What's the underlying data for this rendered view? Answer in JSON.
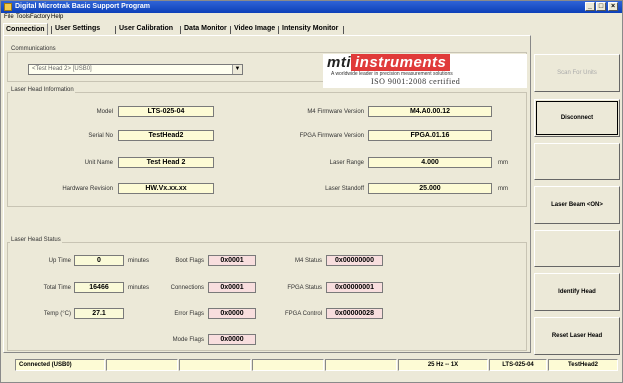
{
  "window": {
    "title": "Digital Microtrak Basic Support Program"
  },
  "menu": [
    "File",
    "Tools",
    "Factory",
    "Help"
  ],
  "tabs": [
    "Connection",
    "User Settings",
    "User Calibration",
    "Data Monitor",
    "Video Image",
    "Intensity Monitor"
  ],
  "communications": {
    "group_label": "Communications",
    "device_select": "<Test Head 2>   [USB0]"
  },
  "logo": {
    "brand_mti": "mti",
    "brand_instruments": "instruments",
    "tagline": "A worldwide leader in precision measurement solutions",
    "iso": "ISO 9001:2008 certified"
  },
  "laser_head_info": {
    "group_label": "Laser Head Information",
    "model_label": "Model",
    "model": "LTS-025-04",
    "serial_label": "Serial No",
    "serial": "TestHead2",
    "unit_name_label": "Unit Name",
    "unit_name": "Test Head 2",
    "hw_rev_label": "Hardware Revision",
    "hw_rev": "HW.Vx.xx.xx",
    "m4_fw_label": "M4 Firmware Version",
    "m4_fw": "M4.A0.00.12",
    "fpga_fw_label": "FPGA Firmware Version",
    "fpga_fw": "FPGA.01.16",
    "range_label": "Laser Range",
    "range": "4.000",
    "range_unit": "mm",
    "standoff_label": "Laser Standoff",
    "standoff": "25.000",
    "standoff_unit": "mm"
  },
  "laser_head_status": {
    "group_label": "Laser Head Status",
    "up_time_label": "Up Time",
    "up_time": "0",
    "up_time_unit": "minutes",
    "total_time_label": "Total Time",
    "total_time": "16466",
    "total_time_unit": "minutes",
    "temp_label": "Temp (°C)",
    "temp": "27.1",
    "boot_flags_label": "Boot Flags",
    "boot_flags": "0x0001",
    "connections_label": "Connections",
    "connections": "0x0001",
    "error_flags_label": "Error Flags",
    "error_flags": "0x0000",
    "mode_flags_label": "Mode Flags",
    "mode_flags": "0x0000",
    "m4_status_label": "M4 Status",
    "m4_status": "0x00000000",
    "fpga_status_label": "FPGA Status",
    "fpga_status": "0x00000001",
    "fpga_control_label": "FPGA Control",
    "fpga_control": "0x00000028"
  },
  "side_buttons": {
    "scan": "Scan For Units",
    "disconnect": "Disconnect",
    "laser_beam": "Laser Beam <ON>",
    "identify": "Identify Head",
    "reset": "Reset Laser Head"
  },
  "statusbar": {
    "connection": "Connected (USB0)",
    "rate": "25 Hz  --  1X",
    "model": "LTS-025-04",
    "serial": "TestHead2"
  }
}
